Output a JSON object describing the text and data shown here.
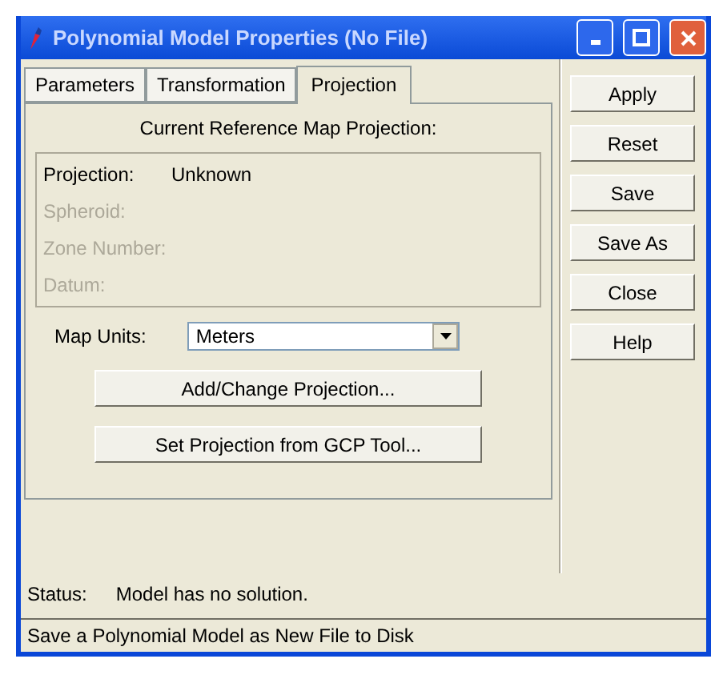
{
  "window": {
    "title": "Polynomial Model Properties (No File)"
  },
  "tabs": [
    {
      "label": "Parameters",
      "selected": false
    },
    {
      "label": "Transformation",
      "selected": false
    },
    {
      "label": "Projection",
      "selected": true
    }
  ],
  "projection_panel": {
    "heading": "Current Reference Map Projection:",
    "fields": [
      {
        "label": "Projection:",
        "value": "Unknown",
        "disabled": false
      },
      {
        "label": "Spheroid:",
        "disabled": true
      },
      {
        "label": "Zone Number:",
        "disabled": true
      },
      {
        "label": "Datum:",
        "disabled": true
      }
    ],
    "map_units": {
      "label": "Map Units:",
      "value": "Meters"
    },
    "buttons": [
      "Add/Change Projection...",
      "Set Projection from GCP Tool..."
    ]
  },
  "side_buttons": [
    "Apply",
    "Reset",
    "Save",
    "Save As",
    "Close",
    "Help"
  ],
  "status": {
    "label": "Status:",
    "value": "Model has no solution."
  },
  "status_bar": "Save a Polynomial Model as New File to Disk"
}
